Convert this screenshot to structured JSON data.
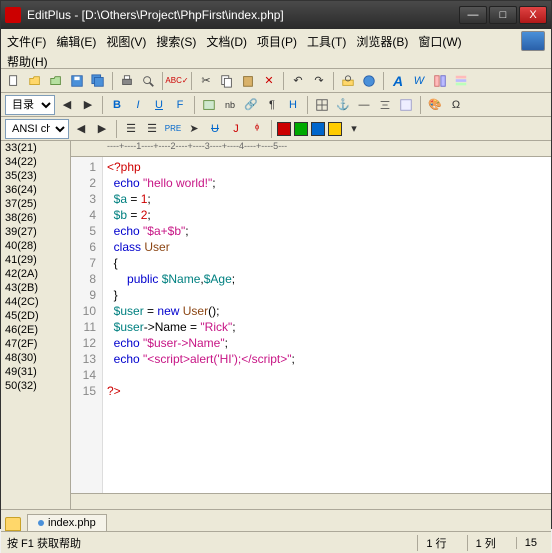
{
  "window": {
    "title": "EditPlus - [D:\\Others\\Project\\PhpFirst\\index.php]",
    "min": "—",
    "max": "□",
    "close": "X"
  },
  "menus": [
    "文件(F)",
    "编辑(E)",
    "视图(V)",
    "搜索(S)",
    "文档(D)",
    "项目(P)",
    "工具(T)",
    "浏览器(B)",
    "窗口(W)",
    "帮助(H)"
  ],
  "toolbar2": {
    "left_label": "目录"
  },
  "toolbar3": {
    "encoding": "ANSI ch"
  },
  "sidebar_items": [
    "33(21)",
    "34(22)",
    "35(23)",
    "36(24)",
    "37(25)",
    "38(26)",
    "39(27)",
    "40(28)",
    "41(29)",
    "42(2A)",
    "43(2B)",
    "44(2C)",
    "45(2D)",
    "46(2E)",
    "47(2F)",
    "48(30)",
    "49(31)",
    "50(32)"
  ],
  "ruler_text": "----+----1----+----2----+----3----+----4----+----5---",
  "code": {
    "lines": [
      {
        "n": 1,
        "html": "<span class='phptag'>&lt;?php</span>"
      },
      {
        "n": 2,
        "html": "  <span class='kw'>echo</span> <span class='str'>\"hello world!\"</span>;"
      },
      {
        "n": 3,
        "html": "  <span class='var'>$a</span> = <span class='num'>1</span>;"
      },
      {
        "n": 4,
        "html": "  <span class='var'>$b</span> = <span class='num'>2</span>;"
      },
      {
        "n": 5,
        "html": "  <span class='kw'>echo</span> <span class='str'>\"$a+$b\"</span>;"
      },
      {
        "n": 6,
        "html": "  <span class='kw'>class</span> <span class='fn'>User</span>"
      },
      {
        "n": 7,
        "html": "  {"
      },
      {
        "n": 8,
        "html": "      <span class='kw'>public</span> <span class='var'>$Name</span>,<span class='var'>$Age</span>;"
      },
      {
        "n": 9,
        "html": "  }"
      },
      {
        "n": 10,
        "html": "  <span class='var'>$user</span> = <span class='kw'>new</span> <span class='fn'>User</span>();"
      },
      {
        "n": 11,
        "html": "  <span class='var'>$user</span>-&gt;Name = <span class='str'>\"Rick\"</span>;"
      },
      {
        "n": 12,
        "html": "  <span class='kw'>echo</span> <span class='str'>\"$user-&gt;Name\"</span>;"
      },
      {
        "n": 13,
        "html": "  <span class='kw'>echo</span> <span class='str'>\"&lt;script&gt;alert('HI');&lt;/script&gt;\"</span>;"
      },
      {
        "n": 14,
        "html": ""
      },
      {
        "n": 15,
        "html": "<span class='phptag'>?&gt;</span>"
      }
    ]
  },
  "filetab": {
    "name": "index.php",
    "marker": "◆"
  },
  "status": {
    "help": "按 F1 获取帮助",
    "line": "1 行",
    "col": "1 列",
    "count": "15"
  }
}
